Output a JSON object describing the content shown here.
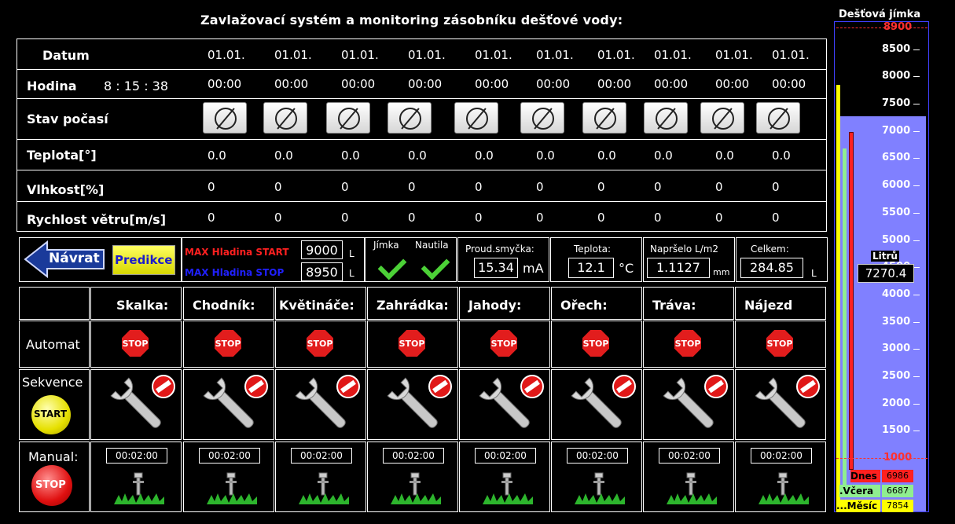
{
  "title": "Zavlažovací systém a monitoring zásobníku dešťové vody:",
  "forecast": {
    "labels": {
      "date": "Datum",
      "hour": "Hodina",
      "weather": "Stav počasí",
      "temp": "Teplota[°]",
      "humidity": "Vlhkost[%]",
      "wind": "Rychlost větru[m/s]"
    },
    "clock": "8 : 15 : 38",
    "columns": [
      {
        "date": "01.01.",
        "hour": "00:00",
        "temp": "0.0",
        "humidity": "0",
        "wind": "0"
      },
      {
        "date": "01.01.",
        "hour": "00:00",
        "temp": "0.0",
        "humidity": "0",
        "wind": "0"
      },
      {
        "date": "01.01.",
        "hour": "00:00",
        "temp": "0.0",
        "humidity": "0",
        "wind": "0"
      },
      {
        "date": "01.01.",
        "hour": "00:00",
        "temp": "0.0",
        "humidity": "0",
        "wind": "0"
      },
      {
        "date": "01.01.",
        "hour": "00:00",
        "temp": "0.0",
        "humidity": "0",
        "wind": "0"
      },
      {
        "date": "01.01.",
        "hour": "00:00",
        "temp": "0.0",
        "humidity": "0",
        "wind": "0"
      },
      {
        "date": "01.01.",
        "hour": "00:00",
        "temp": "0.0",
        "humidity": "0",
        "wind": "0"
      },
      {
        "date": "01.01.",
        "hour": "00:00",
        "temp": "0.0",
        "humidity": "0",
        "wind": "0"
      },
      {
        "date": "01.01.",
        "hour": "00:00",
        "temp": "0.0",
        "humidity": "0",
        "wind": "0"
      },
      {
        "date": "01.01.",
        "hour": "00:00",
        "temp": "0.0",
        "humidity": "0",
        "wind": "0"
      }
    ]
  },
  "controls": {
    "back_label": "Návrat",
    "predict_label": "Predikce",
    "max_start_label": "MAX Hladina START",
    "max_start_value": "9000",
    "max_stop_label": "MAX Hladina STOP",
    "max_stop_value": "8950",
    "unit_l": "L",
    "jimka_label": "Jímka",
    "nautila_label": "Nautila",
    "current_label": "Proud.smyčka:",
    "current_value": "15.34",
    "current_unit": "mA",
    "temp_label": "Teplota:",
    "temp_value": "12.1",
    "temp_unit": "°C",
    "rain_label": "Napršelo L/m2",
    "rain_value": "1.1127",
    "rain_unit": "mm",
    "total_label": "Celkem:",
    "total_value": "284.85",
    "total_unit": "L"
  },
  "zones": {
    "names": [
      "Skalka:",
      "Chodník:",
      "Květináče:",
      "Zahrádka:",
      "Jahody:",
      "Ořech:",
      "Tráva:",
      "Nájezd"
    ],
    "row_automat": "Automat",
    "row_sequence": "Sekvence",
    "row_manual": "Manual:",
    "stop_text": "STOP",
    "start_text": "START",
    "timers": [
      "00:02:00",
      "00:02:00",
      "00:02:00",
      "00:02:00",
      "00:02:00",
      "00:02:00",
      "00:02:00",
      "00:02:00"
    ]
  },
  "tank": {
    "title": "Dešťová jímka",
    "max": "8900",
    "min": "1000",
    "ticks": [
      "8500",
      "8000",
      "7500",
      "7000",
      "6500",
      "6000",
      "5500",
      "5000",
      "4500",
      "4000",
      "3500",
      "3000",
      "2500",
      "2000",
      "1500"
    ],
    "liters_label": "Litrů",
    "liters_value": "7270.4",
    "level_fraction": 0.8163,
    "today_label": "Dnes",
    "today_value": "6986",
    "yesterday_label": ".Včera",
    "yesterday_value": "6687",
    "month_label": "...Měsíc",
    "month_value": "7854",
    "colors": {
      "fill": "#8080ff",
      "today": "#ff2020",
      "yesterday": "#90ee90",
      "month": "#ffff00",
      "limit": "#ff3030"
    }
  }
}
